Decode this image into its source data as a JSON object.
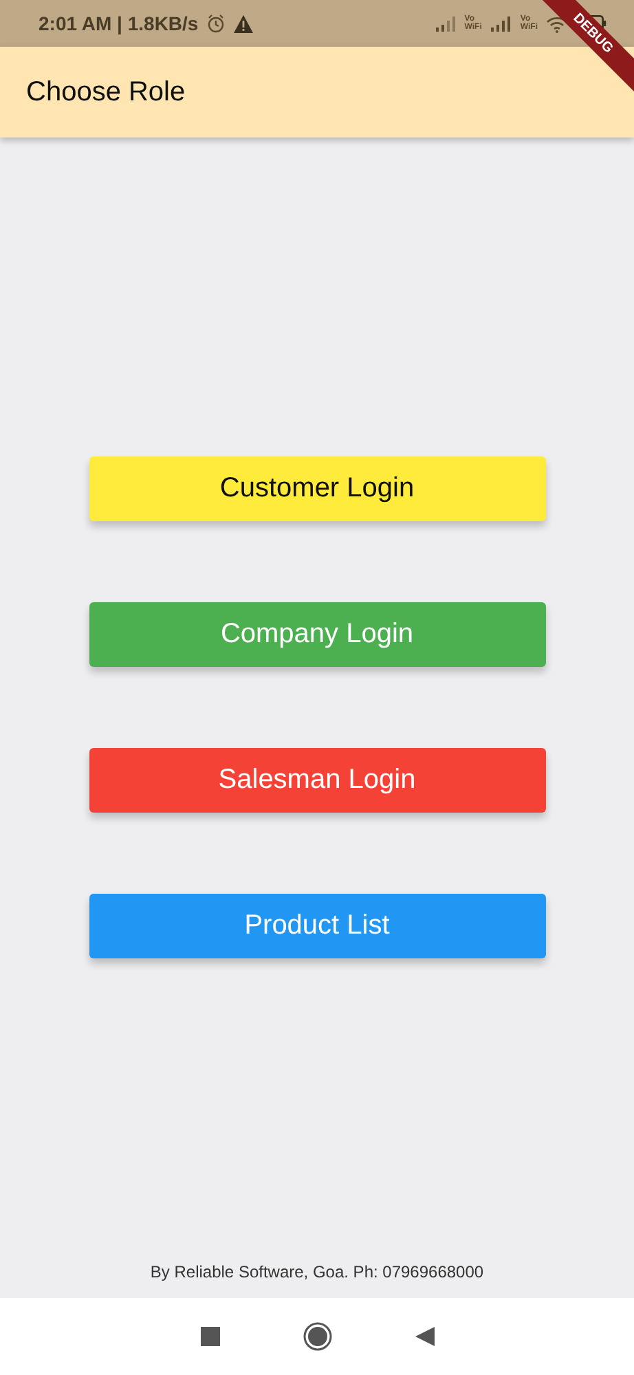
{
  "status_bar": {
    "time": "2:01 AM | 1.8KB/s",
    "network_labels": [
      "Vo\nWiFi",
      "Vo\nWiFi"
    ]
  },
  "debug_banner": "DEBUG",
  "app_bar": {
    "title": "Choose Role"
  },
  "buttons": [
    {
      "label": "Customer Login",
      "color": "#ffeb3b"
    },
    {
      "label": "Company Login",
      "color": "#4caf50"
    },
    {
      "label": "Salesman Login",
      "color": "#f44336"
    },
    {
      "label": "Product List",
      "color": "#2196f3"
    }
  ],
  "footer": "By Reliable Software, Goa. Ph: 07969668000"
}
